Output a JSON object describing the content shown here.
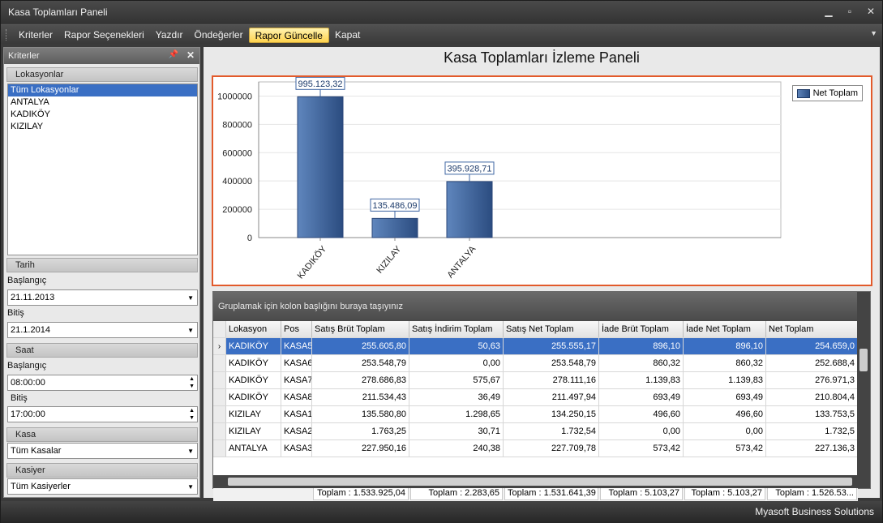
{
  "window": {
    "title": "Kasa Toplamları Paneli"
  },
  "menu": {
    "items": [
      "Kriterler",
      "Rapor Seçenekleri",
      "Yazdır",
      "Öndeğerler",
      "Rapor Güncelle",
      "Kapat"
    ],
    "active_index": 4
  },
  "left_panel": {
    "title": "Kriterler",
    "lokasyonlar": {
      "label": "Lokasyonlar",
      "items": [
        "Tüm Lokasyonlar",
        "ANTALYA",
        "KADIKÖY",
        "KIZILAY"
      ],
      "selected_index": 0
    },
    "tarih": {
      "label": "Tarih",
      "start_label": "Başlangıç",
      "start_value": "21.11.2013",
      "end_label": "Bitiş",
      "end_value": "21.1.2014"
    },
    "saat": {
      "label": "Saat",
      "start_label": "Başlangıç",
      "start_value": "08:00:00",
      "end_label": "Bitiş",
      "end_value": "17:00:00"
    },
    "kasa": {
      "label": "Kasa",
      "value": "Tüm Kasalar"
    },
    "kasiyer": {
      "label": "Kasiyer",
      "value": "Tüm Kasiyerler"
    }
  },
  "main": {
    "title": "Kasa Toplamları İzleme Paneli"
  },
  "chart_data": {
    "type": "bar",
    "categories": [
      "KADIKÖY",
      "KIZILAY",
      "ANTALYA"
    ],
    "series": [
      {
        "name": "Net Toplam",
        "values": [
          995123.32,
          135486.09,
          395928.71
        ],
        "labels": [
          "995.123,32",
          "135.486,09",
          "395.928,71"
        ]
      }
    ],
    "y_ticks": [
      "0",
      "200000",
      "400000",
      "600000",
      "800000",
      "1000000"
    ],
    "ylim": [
      0,
      1100000
    ],
    "legend_position": "top-right",
    "grid": true,
    "colors": {
      "bar": "#3d65a3"
    }
  },
  "grid": {
    "group_hint": "Gruplamak için kolon başlığını buraya taşıyınız",
    "columns": [
      "Lokasyon",
      "Pos",
      "Satış Brüt Toplam",
      "Satış İndirim Toplam",
      "Satış Net Toplam",
      "İade Brüt Toplam",
      "İade Net Toplam",
      "Net Toplam"
    ],
    "rows": [
      [
        "KADIKÖY",
        "KASA5",
        "255.605,80",
        "50,63",
        "255.555,17",
        "896,10",
        "896,10",
        "254.659,0"
      ],
      [
        "KADIKÖY",
        "KASA6",
        "253.548,79",
        "0,00",
        "253.548,79",
        "860,32",
        "860,32",
        "252.688,4"
      ],
      [
        "KADIKÖY",
        "KASA7",
        "278.686,83",
        "575,67",
        "278.111,16",
        "1.139,83",
        "1.139,83",
        "276.971,3"
      ],
      [
        "KADIKÖY",
        "KASA8",
        "211.534,43",
        "36,49",
        "211.497,94",
        "693,49",
        "693,49",
        "210.804,4"
      ],
      [
        "KIZILAY",
        "KASA1",
        "135.580,80",
        "1.298,65",
        "134.250,15",
        "496,60",
        "496,60",
        "133.753,5"
      ],
      [
        "KIZILAY",
        "KASA2",
        "1.763,25",
        "30,71",
        "1.732,54",
        "0,00",
        "0,00",
        "1.732,5"
      ],
      [
        "ANTALYA",
        "KASA3",
        "227.950,16",
        "240,38",
        "227.709,78",
        "573,42",
        "573,42",
        "227.136,3"
      ]
    ],
    "selected_row": 0,
    "totals": [
      "Toplam : 1.533.925,04",
      "Toplam : 2.283,65",
      "Toplam : 1.531.641,39",
      "Toplam : 5.103,27",
      "Toplam : 5.103,27",
      "Toplam : 1.526.53..."
    ]
  },
  "status": {
    "company": "Myasoft Business Solutions"
  }
}
